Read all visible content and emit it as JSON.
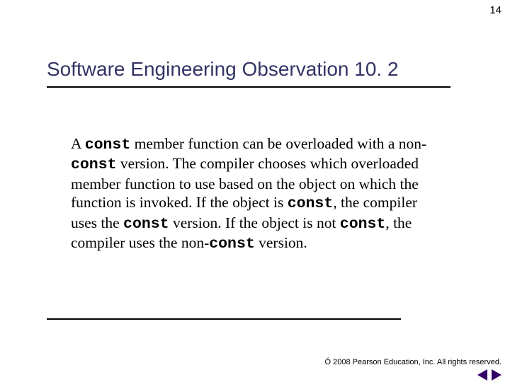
{
  "page_number": "14",
  "title": "Software Engineering Observation 10. 2",
  "body": [
    "A ",
    "const",
    " member function can be overloaded with a non-",
    "const",
    " version. The compiler chooses which overloaded member function to use based on the object on which the function is invoked. If the object is ",
    "const",
    ", the compiler uses the ",
    "const",
    " version. If the object is not ",
    "const",
    ", the compiler uses the non-",
    "const",
    " version."
  ],
  "copyright": {
    "symbol": "Ó",
    "text": " 2008 Pearson Education, Inc. All rights reserved."
  },
  "nav": {
    "prev": "Previous",
    "next": "Next"
  }
}
